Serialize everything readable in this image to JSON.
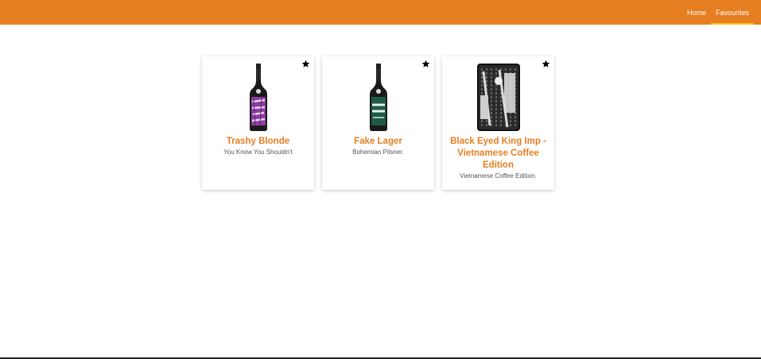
{
  "nav": {
    "home_label": "Home",
    "favourites_label": "Favourites",
    "active_color": "#f6c40f"
  },
  "theme": {
    "brand": "#e67e22",
    "text_muted": "#555555"
  },
  "beers": [
    {
      "name": "Trashy Blonde",
      "tagline": "You Know You Shouldn't",
      "favourited": true,
      "image": "bottle-icon",
      "label_color": "#8b3fa0"
    },
    {
      "name": "Fake Lager",
      "tagline": "Bohemian Pilsner.",
      "favourited": true,
      "image": "bottle-icon",
      "label_color": "#1f5a48"
    },
    {
      "name": "Black Eyed King Imp - Vietnamese Coffee Edition",
      "tagline": "Vietnamese Coffee Edition.",
      "favourited": true,
      "image": "can-icon",
      "label_color": "#111111"
    }
  ]
}
